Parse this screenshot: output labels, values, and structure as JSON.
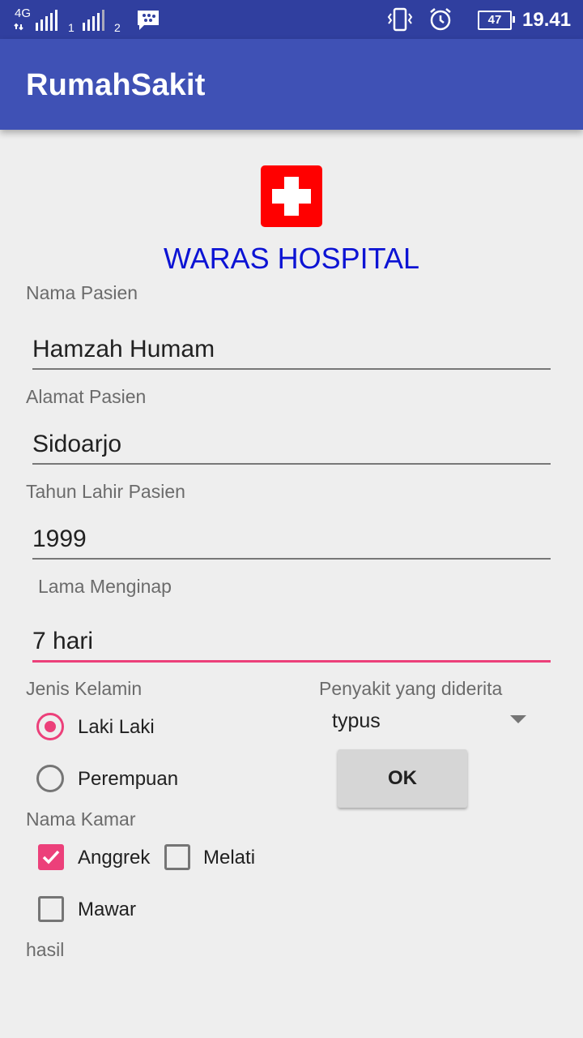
{
  "status_bar": {
    "network": "4G",
    "sim1": "1",
    "sim2": "2",
    "battery": "47",
    "time": "19.41",
    "icons": [
      "signal-icon",
      "bbm-icon",
      "vibrate-icon",
      "alarm-icon",
      "battery-icon"
    ]
  },
  "app_bar": {
    "title": "RumahSakit"
  },
  "header": {
    "hospital_name": "WARAS HOSPITAL"
  },
  "form": {
    "nama": {
      "label": "Nama Pasien",
      "value": "Hamzah Humam"
    },
    "alamat": {
      "label": "Alamat Pasien",
      "value": "Sidoarjo"
    },
    "tahun": {
      "label": "Tahun Lahir Pasien",
      "value": "1999"
    },
    "lama": {
      "label": "Lama Menginap",
      "value": "7 hari"
    },
    "gender": {
      "label": "Jenis Kelamin",
      "options": [
        {
          "label": "Laki Laki",
          "checked": true
        },
        {
          "label": "Perempuan",
          "checked": false
        }
      ]
    },
    "disease": {
      "label": "Penyakit yang diderita",
      "selected": "typus"
    },
    "ok_label": "OK",
    "room": {
      "label": "Nama Kamar",
      "options": [
        {
          "label": "Anggrek",
          "checked": true
        },
        {
          "label": "Melati",
          "checked": false
        },
        {
          "label": "Mawar",
          "checked": false
        }
      ]
    },
    "result_label": "hasil"
  },
  "colors": {
    "status_bar": "#303f9f",
    "app_bar": "#3f51b5",
    "accent": "#ec407a",
    "hospital_title": "#0c13d4",
    "logo": "#ff0000"
  }
}
